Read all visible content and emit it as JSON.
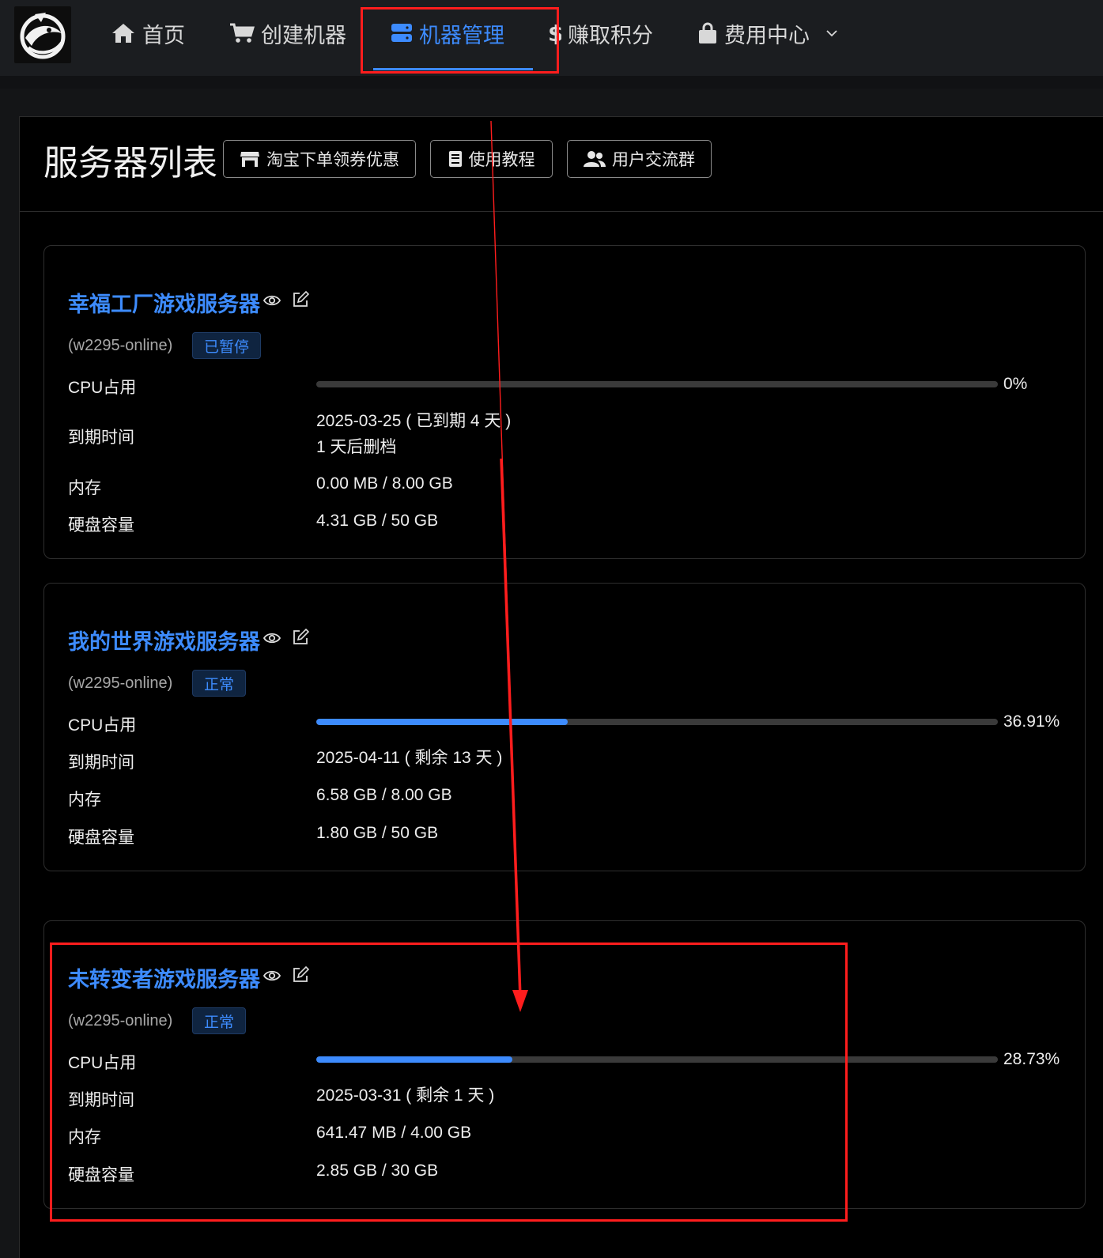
{
  "nav": {
    "items": [
      {
        "label": "首页",
        "icon": "home-icon"
      },
      {
        "label": "创建机器",
        "icon": "cart-icon"
      },
      {
        "label": "机器管理",
        "icon": "server-icon",
        "active": true
      },
      {
        "label": "赚取积分",
        "icon": "dollar-icon"
      },
      {
        "label": "费用中心",
        "icon": "bag-icon"
      }
    ],
    "accent": "#3d8bfd"
  },
  "header": {
    "title": "服务器列表",
    "buttons": [
      {
        "label": "淘宝下单领券优惠",
        "icon": "shop-icon"
      },
      {
        "label": "使用教程",
        "icon": "book-icon"
      },
      {
        "label": "用户交流群",
        "icon": "users-icon"
      }
    ]
  },
  "labels": {
    "cpu": "CPU占用",
    "expire": "到期时间",
    "memory": "内存",
    "disk": "硬盘容量"
  },
  "servers": [
    {
      "name": "幸福工厂游戏服务器",
      "host": "(w2295-online)",
      "status": "已暂停",
      "cpu": "0%",
      "cpu_value": 0,
      "expire": "2025-03-25 ( 已到期 4 天 )",
      "expire_note": "1 天后删档",
      "memory": "0.00 MB / 8.00 GB",
      "disk": "4.31 GB / 50 GB"
    },
    {
      "name": "我的世界游戏服务器",
      "host": "(w2295-online)",
      "status": "正常",
      "cpu": "36.91%",
      "cpu_value": 36.91,
      "expire": "2025-04-11 ( 剩余 13 天 )",
      "memory": "6.58 GB / 8.00 GB",
      "disk": "1.80 GB / 50 GB"
    },
    {
      "name": "未转变者游戏服务器",
      "host": "(w2295-online)",
      "status": "正常",
      "cpu": "28.73%",
      "cpu_value": 28.73,
      "expire": "2025-03-31 ( 剩余 1 天 )",
      "memory": "641.47 MB / 4.00 GB",
      "disk": "2.85 GB / 30 GB"
    }
  ],
  "annotation_color": "#ff1d1d"
}
